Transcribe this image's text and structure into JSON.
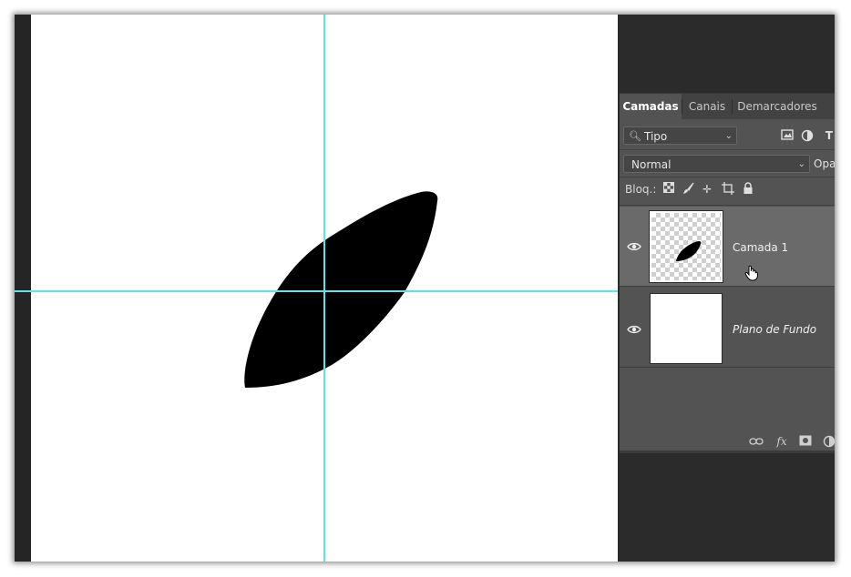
{
  "layers_panel": {
    "tabs": [
      {
        "label": "Camadas",
        "active": true
      },
      {
        "label": "Canais",
        "active": false
      },
      {
        "label": "Demarcadores",
        "active": false
      }
    ],
    "filter": {
      "label": "Tipo",
      "icon": "search-icon"
    },
    "filter_icons": [
      "image-filter-icon",
      "adjustment-filter-icon",
      "type-filter-icon"
    ],
    "blend_mode": "Normal",
    "opacity_label": "Opa",
    "lock_label": "Bloq.:",
    "lock_icons": [
      "lock-transparent-pixels-icon",
      "lock-image-pixels-icon",
      "lock-position-icon",
      "lock-artboard-icon",
      "lock-all-icon"
    ],
    "layers": [
      {
        "name": "Camada 1",
        "visible": true,
        "selected": true,
        "thumbnail": "transparent-with-leaf-shape"
      },
      {
        "name": "Plano de Fundo",
        "visible": true,
        "selected": false,
        "thumbnail": "white"
      }
    ],
    "bottom_icons": [
      "link-layers-icon",
      "fx-icon",
      "add-mask-icon",
      "adjustment-layer-icon"
    ],
    "fx_label": "fx"
  },
  "canvas": {
    "background": "#ffffff",
    "guide_color": "#5fe3ea",
    "shape": "black-leaf-shape"
  },
  "colors": {
    "workspace": "#252525",
    "panel": "#535353",
    "selected_layer": "#6a6a6a"
  }
}
